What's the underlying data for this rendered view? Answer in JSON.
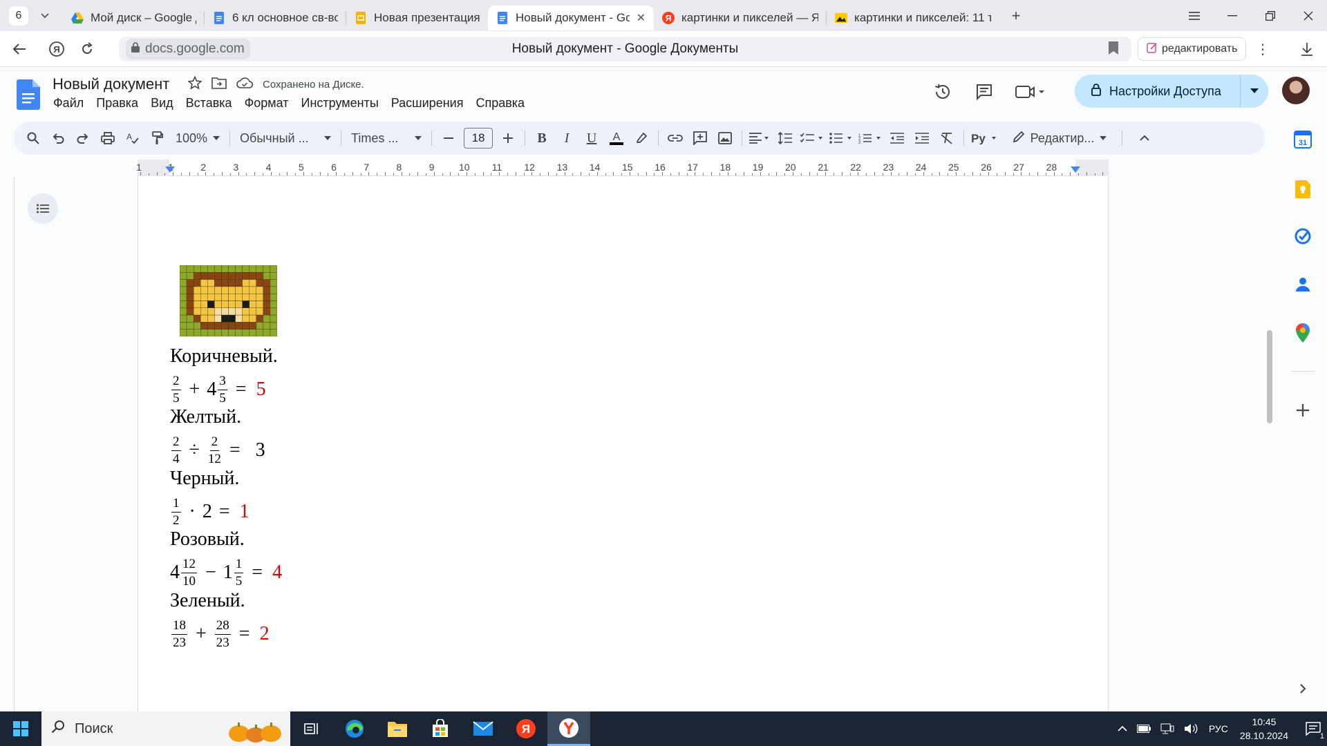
{
  "browser": {
    "tab_count": "6",
    "tabs": [
      {
        "title": "Мой диск – Google Диск",
        "icon": "google-drive-icon",
        "active": false
      },
      {
        "title": "6 кл основное св-во дроб",
        "icon": "google-docs-icon",
        "active": false
      },
      {
        "title": "Новая презентация - Goo",
        "icon": "google-slides-icon",
        "active": false
      },
      {
        "title": "Новый документ - Goo",
        "icon": "google-docs-icon",
        "active": true
      },
      {
        "title": "картинки и пикселей — Я",
        "icon": "yandex-icon",
        "active": false
      },
      {
        "title": "картинки и пикселей: 11 т",
        "icon": "yandex-images-icon",
        "active": false
      }
    ],
    "url": "docs.google.com",
    "page_title": "Новый документ - Google Документы",
    "edit_button": "редактировать"
  },
  "docs": {
    "title": "Новый документ",
    "saved_status": "Сохранено на Диске.",
    "menu": [
      "Файл",
      "Правка",
      "Вид",
      "Вставка",
      "Формат",
      "Инструменты",
      "Расширения",
      "Справка"
    ],
    "share_button": "Настройки Доступа",
    "toolbar": {
      "zoom": "100%",
      "style": "Обычный ...",
      "font": "Times ...",
      "font_size": "18",
      "mode": "Редактир..."
    },
    "ruler_numbers": [
      "1",
      "1",
      "2",
      "3",
      "4",
      "5",
      "6",
      "7",
      "8",
      "9",
      "10",
      "11",
      "12",
      "13",
      "14",
      "15",
      "16",
      "17",
      "18",
      "19",
      "20",
      "21",
      "22",
      "23",
      "24",
      "25",
      "26",
      "27",
      "28"
    ]
  },
  "document": {
    "image": {
      "name": "pixel-art-lion",
      "colors": {
        "grass": "#8fa829",
        "dark_brown": "#8b4513",
        "yellow": "#f5c542",
        "light": "#f7dda0",
        "black": "#1a1a1a"
      }
    },
    "blocks": [
      {
        "color": "Коричневый.",
        "math": {
          "a_whole": "",
          "a_num": "2",
          "a_den": "5",
          "op": "+",
          "b_whole": "4",
          "b_num": "3",
          "b_den": "5",
          "answer": "5",
          "answer_color": "red"
        }
      },
      {
        "color": "Желтый.",
        "math": {
          "a_whole": "",
          "a_num": "2",
          "a_den": "4",
          "op": "÷",
          "b_whole": "",
          "b_num": "2",
          "b_den": "12",
          "answer": "3",
          "answer_color": "black"
        }
      },
      {
        "color": "Черный.",
        "math": {
          "a_whole": "",
          "a_num": "1",
          "a_den": "2",
          "op": "·",
          "b_plain": "2",
          "answer": "1",
          "answer_color": "red"
        }
      },
      {
        "color": "Розовый.",
        "math": {
          "a_whole": "4",
          "a_num": "12",
          "a_den": "10",
          "op": "−",
          "b_whole": "1",
          "b_num": "1",
          "b_den": "5",
          "answer": "4",
          "answer_color": "red"
        }
      },
      {
        "color": "Зеленый.",
        "math": {
          "a_whole": "",
          "a_num": "18",
          "a_den": "23",
          "op": "+",
          "b_whole": "",
          "b_num": "28",
          "b_den": "23",
          "answer": "2",
          "answer_color": "red"
        }
      }
    ],
    "equals": "="
  },
  "taskbar": {
    "search": "Поиск",
    "language": "РУС",
    "time": "10:45",
    "date": "28.10.2024",
    "notifications": "1"
  }
}
